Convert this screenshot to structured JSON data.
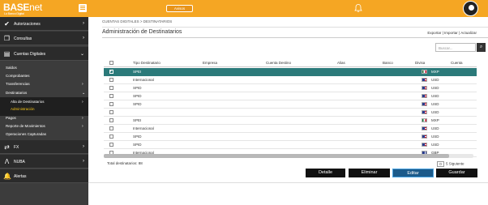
{
  "app": {
    "logo_main": "BASE",
    "logo_accent": "net",
    "logo_sub": "Lo Banco Digital",
    "top_button": "Avisos"
  },
  "sidebar": {
    "main_items": [
      {
        "label": "Autorizaciones",
        "icon": "check-icon"
      },
      {
        "label": "Consultas",
        "icon": "copy-icon"
      },
      {
        "label": "Cuentas Digitales",
        "icon": "cards-icon"
      },
      {
        "label": "FX",
        "icon": "exchange-icon"
      },
      {
        "label": "NUBA",
        "icon": "nuba-icon"
      },
      {
        "label": "Alertas",
        "icon": "bell-alert-icon"
      }
    ],
    "sub_items": [
      {
        "label": "Saldos"
      },
      {
        "label": "Comprobantes"
      },
      {
        "label": "Transferencias"
      },
      {
        "label": "Destinatarios"
      },
      {
        "label": "Alta de Destinatarios"
      },
      {
        "label": "Administración"
      },
      {
        "label": "Pagos"
      },
      {
        "label": "Reporte de Movimientos"
      },
      {
        "label": "Operaciones Capturadas"
      }
    ]
  },
  "breadcrumb": "CUENTAS DIGITALES > DESTINATARIOS",
  "page_title": "Administración de Destinatarios",
  "actions": {
    "export": "Exportar",
    "sep1": " | ",
    "import": "Importar",
    "sep2": " | ",
    "refresh": "Actualizar"
  },
  "search": {
    "placeholder": "Buscar..."
  },
  "table": {
    "headers": [
      "Tipo Destinatario",
      "Empresa",
      "Cuenta Destino",
      "Alias",
      "Banco",
      "Divisa",
      "Cuenta"
    ],
    "rows": [
      {
        "tipo": "SPEI",
        "divisa": "MXP",
        "flag": "mx",
        "selected": true
      },
      {
        "tipo": "Internacional",
        "divisa": "USD",
        "flag": "us",
        "selected": false
      },
      {
        "tipo": "SPID",
        "divisa": "USD",
        "flag": "us",
        "selected": false
      },
      {
        "tipo": "SPID",
        "divisa": "USD",
        "flag": "us",
        "selected": false
      },
      {
        "tipo": "SPID",
        "divisa": "USD",
        "flag": "us",
        "selected": false
      },
      {
        "tipo": "",
        "divisa": "USD",
        "flag": "us",
        "selected": false
      },
      {
        "tipo": "SPEI",
        "divisa": "MXP",
        "flag": "mx",
        "selected": false
      },
      {
        "tipo": "Internacional",
        "divisa": "USD",
        "flag": "us",
        "selected": false
      },
      {
        "tipo": "SPID",
        "divisa": "USD",
        "flag": "us",
        "selected": false
      },
      {
        "tipo": "SPID",
        "divisa": "USD",
        "flag": "us",
        "selected": false
      },
      {
        "tipo": "Internacional",
        "divisa": "GBP",
        "flag": "gb",
        "selected": false
      }
    ]
  },
  "footer": {
    "total": "Total destinatarios: 88",
    "page_value": "0",
    "page_text": "5 Siguiente"
  },
  "buttons": {
    "detalle": "Detalle",
    "eliminar": "Eliminar",
    "editar": "Editar",
    "guardar": "Guardar"
  }
}
